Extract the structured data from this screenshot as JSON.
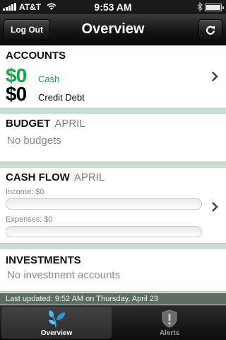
{
  "status_bar": {
    "carrier": "AT&T",
    "time": "9:53 AM"
  },
  "nav": {
    "title": "Overview",
    "logout_label": "Log Out",
    "refresh_icon": "refresh-icon"
  },
  "accounts": {
    "title": "ACCOUNTS",
    "cash_amount": "$0",
    "cash_label": "Cash",
    "credit_amount": "$0",
    "credit_label": "Credit Debt",
    "colors": {
      "cash": "#19a34a"
    }
  },
  "budget": {
    "title": "BUDGET",
    "month": "APRIL",
    "empty": "No budgets"
  },
  "cash_flow": {
    "title": "CASH FLOW",
    "month": "APRIL",
    "income_label": "Income: $0",
    "expenses_label": "Expenses: $0",
    "income_fraction": 0,
    "expenses_fraction": 0
  },
  "investments": {
    "title": "INVESTMENTS",
    "empty": "No investment accounts"
  },
  "footer": {
    "last_updated": "Last updated: 9:52 AM on Thursday, April 23"
  },
  "tabs": [
    {
      "label": "Overview",
      "icon": "leaf-icon",
      "active": true
    },
    {
      "label": "Alerts",
      "icon": "alert-shield-icon",
      "active": false
    }
  ]
}
